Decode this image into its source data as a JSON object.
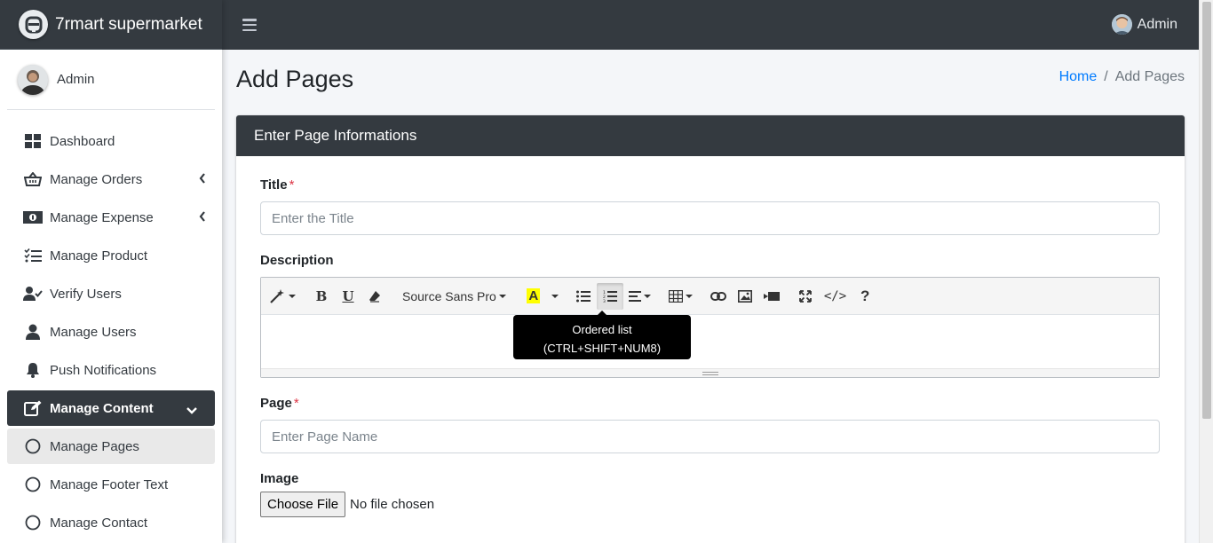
{
  "brand": {
    "name": "7rmart supermarket"
  },
  "sidebar": {
    "user": "Admin",
    "items": [
      {
        "label": "Dashboard",
        "icon": "dashboard-icon"
      },
      {
        "label": "Manage Orders",
        "icon": "basket-icon",
        "expandable": true
      },
      {
        "label": "Manage Expense",
        "icon": "money-icon",
        "expandable": true
      },
      {
        "label": "Manage Product",
        "icon": "list-check-icon"
      },
      {
        "label": "Verify Users",
        "icon": "user-check-icon"
      },
      {
        "label": "Manage Users",
        "icon": "user-icon"
      },
      {
        "label": "Push Notifications",
        "icon": "bell-icon"
      },
      {
        "label": "Manage Content",
        "icon": "edit-icon",
        "expanded": true,
        "active": true
      },
      {
        "label": "Manage Pages",
        "icon": "circle-icon",
        "active": true
      },
      {
        "label": "Manage Footer Text",
        "icon": "circle-icon"
      },
      {
        "label": "Manage Contact",
        "icon": "circle-icon"
      }
    ]
  },
  "topbar": {
    "user": "Admin"
  },
  "header": {
    "title": "Add Pages",
    "breadcrumb": {
      "home": "Home",
      "separator": "/",
      "current": "Add Pages"
    }
  },
  "card": {
    "title": "Enter Page Informations",
    "title_field": {
      "label": "Title",
      "required": "*",
      "placeholder": "Enter the Title"
    },
    "description": {
      "label": "Description",
      "font_select": "Source Sans Pro",
      "tooltip_line1": "Ordered list",
      "tooltip_line2": "(CTRL+SHIFT+NUM8)"
    },
    "page_field": {
      "label": "Page",
      "required": "*",
      "placeholder": "Enter Page Name"
    },
    "image_field": {
      "label": "Image",
      "button": "Choose File",
      "status": "No file chosen"
    }
  },
  "colors": {
    "dark": "#343a40",
    "link": "#007bff",
    "required": "#dc3545",
    "highlight": "#ffff00"
  }
}
